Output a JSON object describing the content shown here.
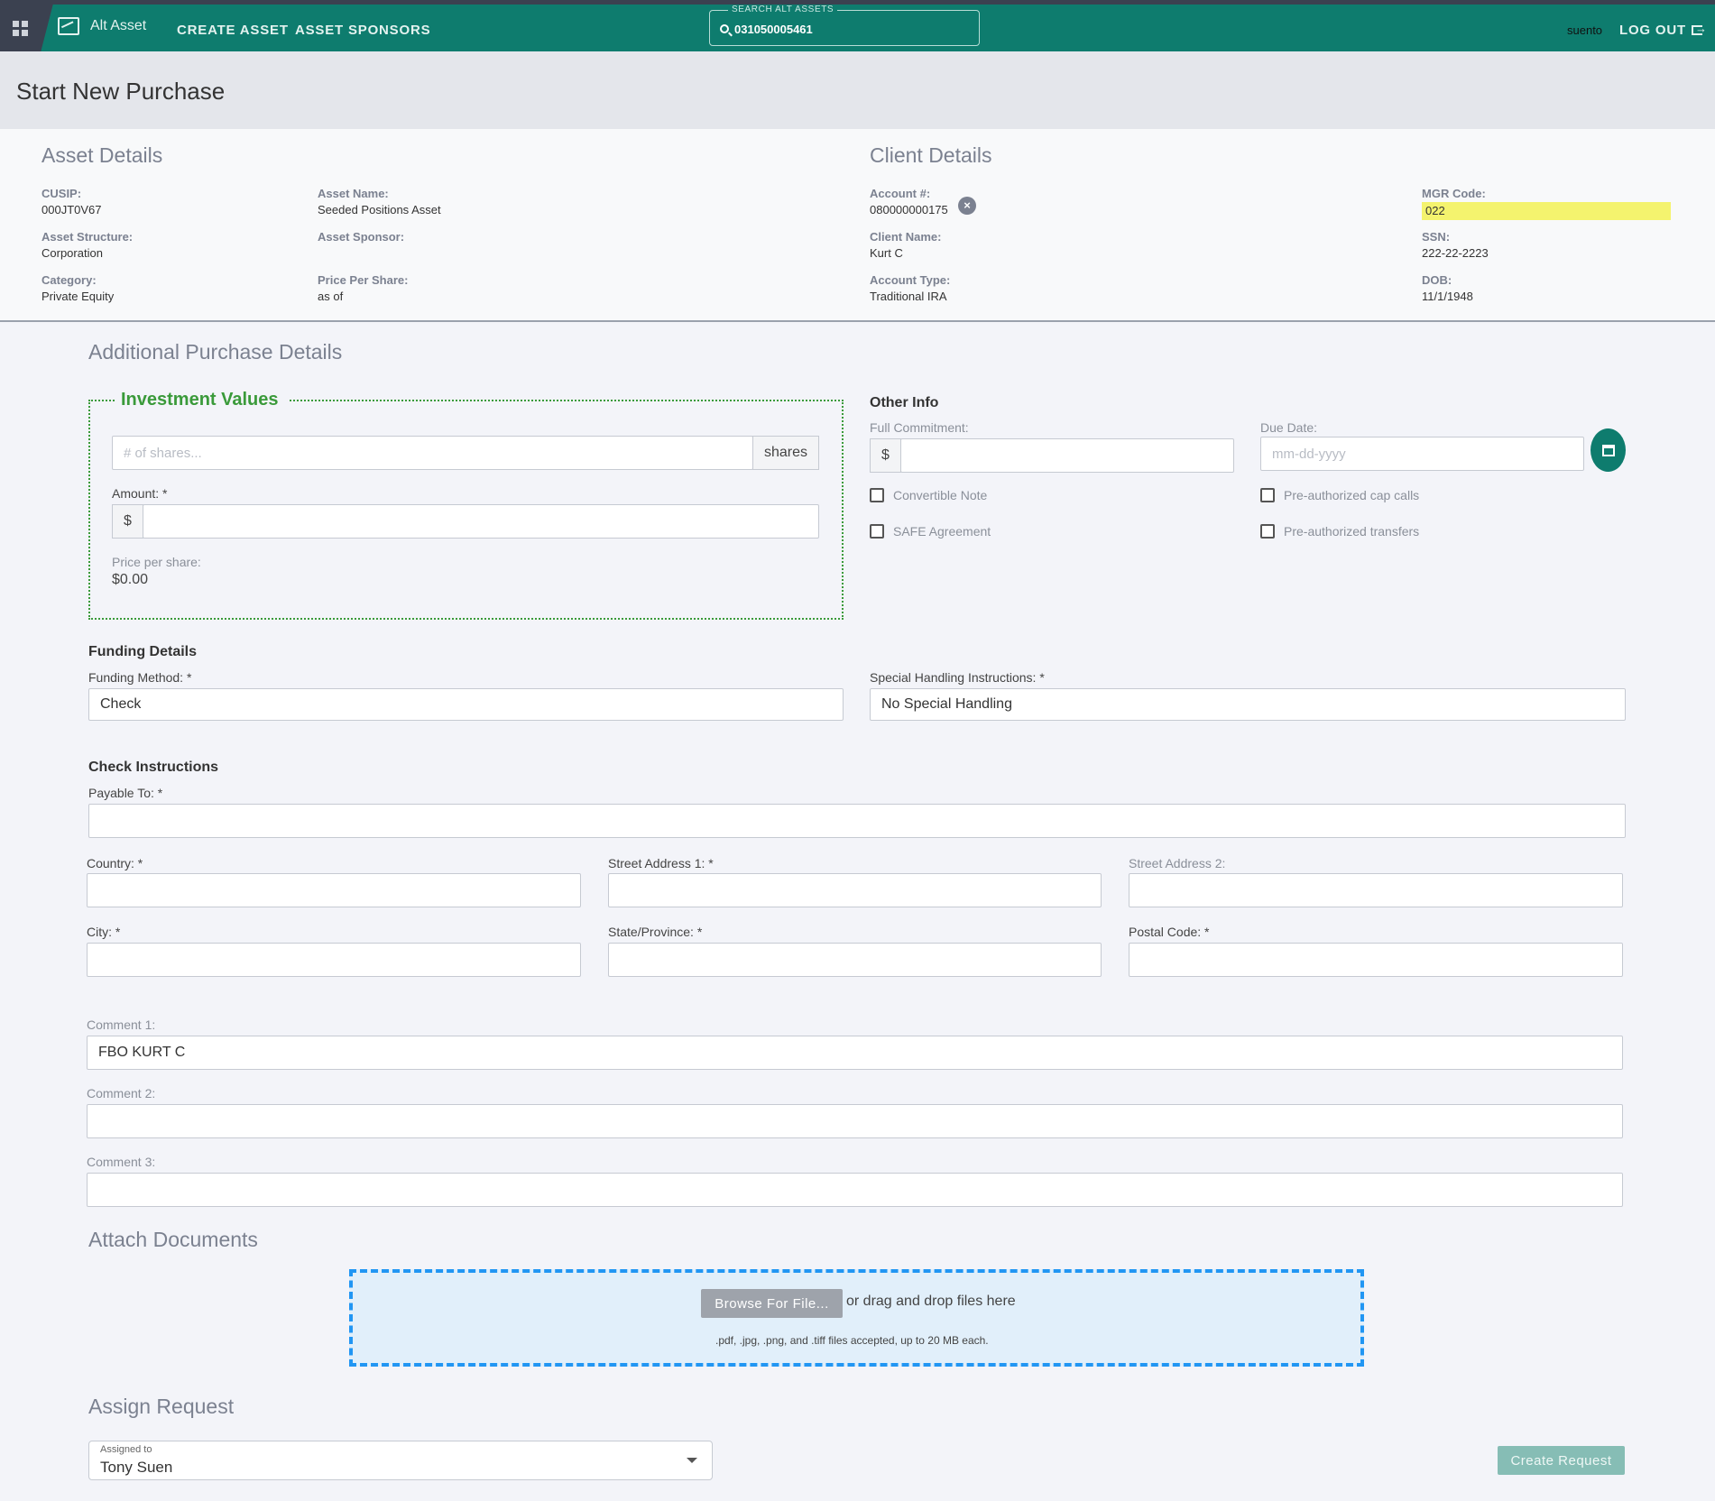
{
  "nav": {
    "brand": "Alt Asset",
    "links": [
      "CREATE ASSET",
      "ASSET SPONSORS"
    ],
    "search_legend": "SEARCH ALT ASSETS",
    "search_value": "031050005461",
    "user": "suento",
    "logout": "LOG OUT"
  },
  "page_title": "Start New Purchase",
  "asset_details": {
    "heading": "Asset Details",
    "cusip_label": "CUSIP:",
    "cusip": "000JT0V67",
    "structure_label": "Asset Structure:",
    "structure": "Corporation",
    "category_label": "Category:",
    "category": "Private Equity",
    "name_label": "Asset Name:",
    "name": "Seeded Positions Asset",
    "sponsor_label": "Asset Sponsor:",
    "price_label": "Price Per Share:",
    "price": "as of"
  },
  "client_details": {
    "heading": "Client Details",
    "account_label": "Account #:",
    "account": "080000000175",
    "client_label": "Client Name:",
    "client": "Kurt C",
    "type_label": "Account Type:",
    "type": "Traditional IRA",
    "mgr_label": "MGR Code:",
    "mgr": "022",
    "ssn_label": "SSN:",
    "ssn": "222-22-2223",
    "dob_label": "DOB:",
    "dob": "11/1/1948"
  },
  "additional": {
    "heading": "Additional Purchase Details",
    "investment": {
      "title": "Investment Values",
      "shares_placeholder": "# of shares...",
      "shares_addon": "shares",
      "amount_label": "Amount: *",
      "currency": "$",
      "pps_label": "Price per share:",
      "pps_value": "$0.00"
    },
    "other": {
      "title": "Other Info",
      "commitment_label": "Full Commitment:",
      "currency": "$",
      "due_label": "Due Date:",
      "due_placeholder": "mm-dd-yyyy",
      "checkboxes": [
        "Convertible Note",
        "SAFE Agreement",
        "Pre-authorized cap calls",
        "Pre-authorized transfers"
      ]
    }
  },
  "funding": {
    "title": "Funding Details",
    "method_label": "Funding Method: *",
    "method": "Check",
    "handling_label": "Special Handling Instructions: *",
    "handling": "No Special Handling"
  },
  "check": {
    "title": "Check Instructions",
    "payable_label": "Payable To: *",
    "country_label": "Country: *",
    "street1_label": "Street Address 1: *",
    "street2_label": "Street Address 2:",
    "city_label": "City: *",
    "state_label": "State/Province: *",
    "postal_label": "Postal Code: *"
  },
  "comments": {
    "c1_label": "Comment 1:",
    "c1": "FBO KURT C",
    "c2_label": "Comment 2:",
    "c3_label": "Comment 3:"
  },
  "attach": {
    "heading": "Attach Documents",
    "browse": "Browse For File...",
    "drag_text": "or drag and drop files here",
    "note": ".pdf, .jpg, .png, and .tiff files accepted, up to 20 MB each."
  },
  "assign": {
    "heading": "Assign Request",
    "label": "Assigned to",
    "value": "Tony Suen",
    "create": "Create Request"
  },
  "colors": {
    "primary": "#0e7c6e",
    "accent_green": "#3a9a3a",
    "highlight": "#f4f36e",
    "drop_border": "#2196f3"
  }
}
